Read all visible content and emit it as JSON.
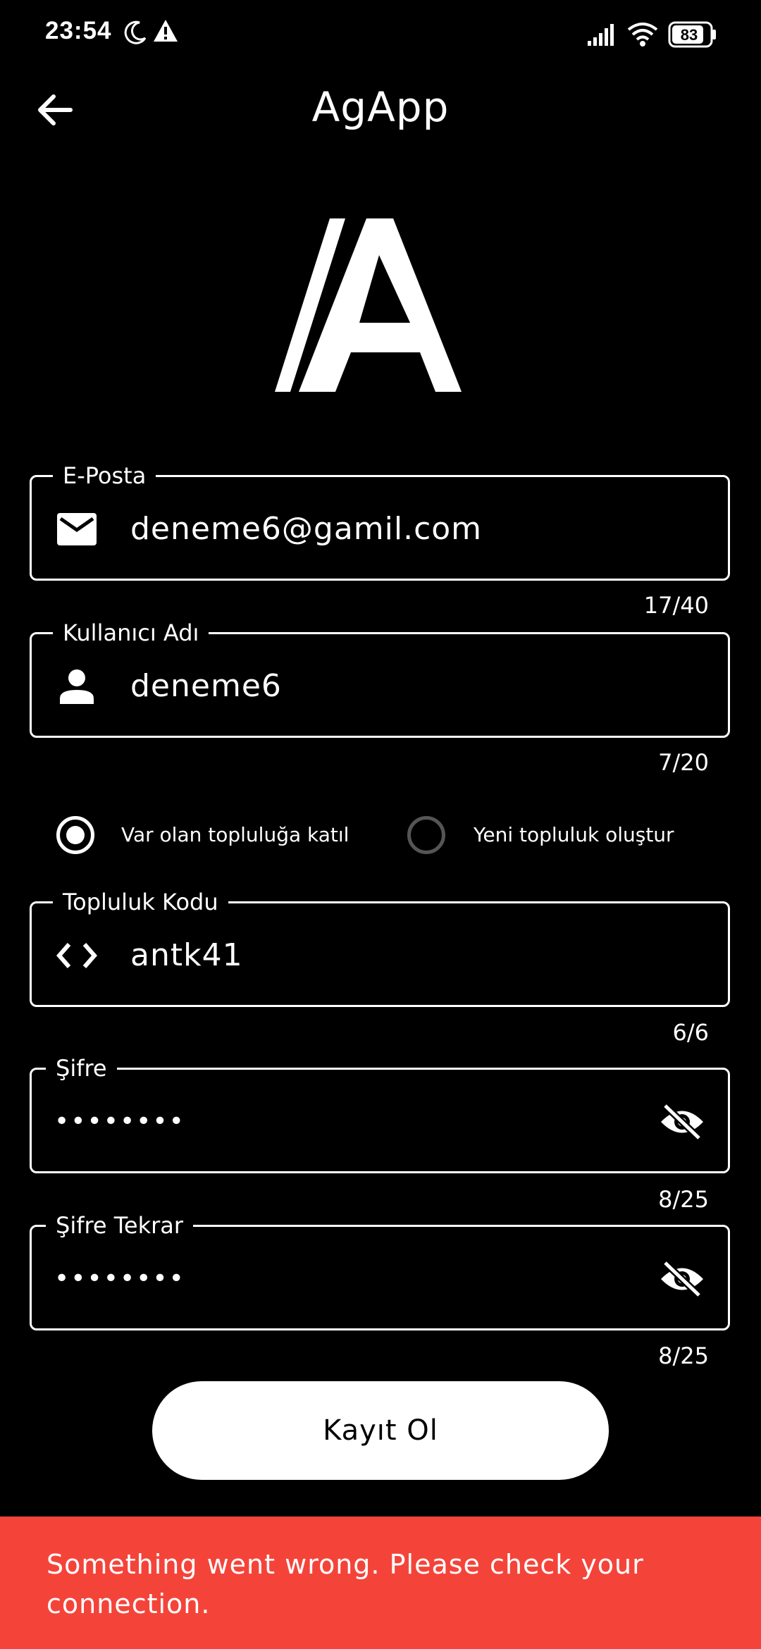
{
  "status_bar": {
    "time": "23:54",
    "battery": "83",
    "icons": [
      "moon-icon",
      "warning-icon",
      "signal-icon",
      "wifi-icon",
      "battery-icon"
    ]
  },
  "app_bar": {
    "title": "AgApp",
    "back_icon": "arrow-left-icon"
  },
  "form": {
    "email": {
      "label": "E-Posta",
      "value": "deneme6@gamil.com",
      "counter": "17/40",
      "icon": "mail-icon"
    },
    "username": {
      "label": "Kullanıcı Adı",
      "value": "deneme6",
      "counter": "7/20",
      "icon": "person-icon"
    },
    "community_mode": {
      "options": [
        {
          "label": "Var olan topluluğa katıl",
          "selected": true
        },
        {
          "label": "Yeni topluluk oluştur",
          "selected": false
        }
      ]
    },
    "community_code": {
      "label": "Topluluk Kodu",
      "value": "antk41",
      "counter": "6/6",
      "icon": "code-icon"
    },
    "password": {
      "label": "Şifre",
      "value": "••••••••",
      "counter": "8/25",
      "icon": "eye-off-icon"
    },
    "password_repeat": {
      "label": "Şifre Tekrar",
      "value": "••••••••",
      "counter": "8/25",
      "icon": "eye-off-icon"
    },
    "submit_label": "Kayıt Ol"
  },
  "snackbar": {
    "message": "Something went wrong. Please check your connection."
  },
  "colors": {
    "background": "#000000",
    "foreground": "#ffffff",
    "error": "#f4443a"
  }
}
